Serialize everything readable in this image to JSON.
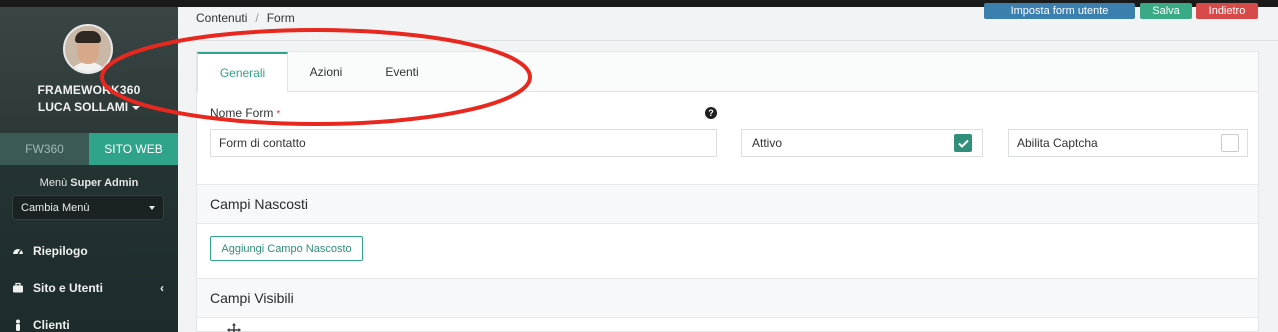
{
  "profile": {
    "line1": "FRAMEWORK360",
    "line2": "LUCA SOLLAMI"
  },
  "switcher": {
    "left": "FW360",
    "right": "SITO WEB"
  },
  "menu": {
    "title_prefix": "Menù",
    "title_bold": "Super Admin",
    "select_value": "Cambia Menù"
  },
  "nav": [
    {
      "label": "Riepilogo",
      "icon": "dashboard-icon"
    },
    {
      "label": "Sito e Utenti",
      "icon": "briefcase-icon",
      "chevron": "‹"
    },
    {
      "label": "Clienti",
      "icon": "user-icon"
    }
  ],
  "breadcrumb": {
    "item1": "Contenuti",
    "separator": "/",
    "item2": "Form"
  },
  "top_buttons": {
    "imposta": "Imposta form utente",
    "salva": "Salva",
    "indietro": "Indietro"
  },
  "tabs": [
    {
      "label": "Generali",
      "active": true
    },
    {
      "label": "Azioni",
      "active": false
    },
    {
      "label": "Eventi",
      "active": false
    }
  ],
  "form": {
    "nome_label": "Nome Form",
    "required_mark": "*",
    "help": "?",
    "nome_value": "Form di contatto",
    "attivo_label": "Attivo",
    "attivo_checked": true,
    "captcha_label": "Abilita Captcha",
    "captcha_checked": false
  },
  "sections": {
    "nascosti": "Campi Nascosti",
    "add_hidden_button": "Aggiungi Campo Nascosto",
    "visibili": "Campi Visibili"
  },
  "colors": {
    "accent": "#2fa48b",
    "annotation": "#e8281f",
    "sidebar": "#1d2b2c"
  }
}
